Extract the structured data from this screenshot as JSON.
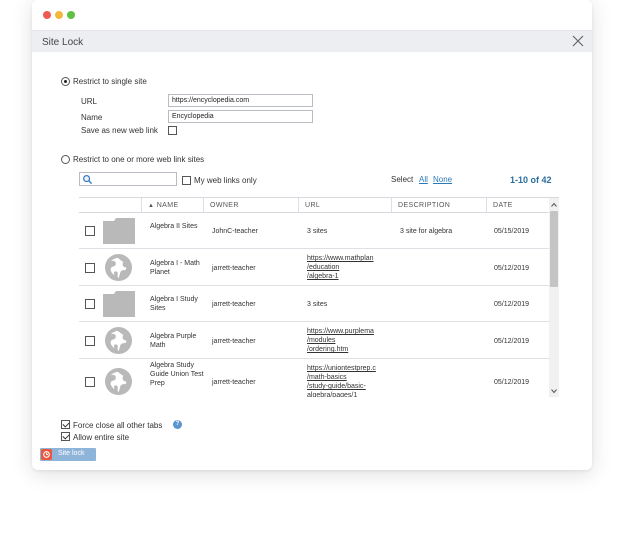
{
  "window": {
    "title": "Site Lock"
  },
  "restrict_single": {
    "label": "Restrict to single site",
    "url_label": "URL",
    "url_value": "https://encyclopedia.com",
    "name_label": "Name",
    "name_value": "Encyclopedia",
    "save_label": "Save as new web link"
  },
  "restrict_multi": {
    "label": "Restrict to one or more web link sites",
    "my_links_label": "My web links only",
    "select_label": "Select",
    "select_all": "All",
    "select_none": "None",
    "count": "1-10 of 42"
  },
  "table": {
    "columns": [
      "NAME",
      "OWNER",
      "URL",
      "DESCRIPTION",
      "DATE"
    ],
    "rows": [
      {
        "icon": "folder-icon",
        "name": "Algebra II Sites",
        "owner": "JohnC-teacher",
        "url": "3 sites",
        "url_is_link": false,
        "description": "3 site for algebra",
        "date": "05/15/2019"
      },
      {
        "icon": "globe-icon",
        "name": "Algebra I - Math Planet",
        "owner": "jarrett-teacher",
        "url": "https://www.mathplan /education /algebra-1",
        "url_is_link": true,
        "description": "",
        "date": "05/12/2019"
      },
      {
        "icon": "folder-icon",
        "name": "Algebra I Study Sites",
        "owner": "jarrett-teacher",
        "url": "3 sites",
        "url_is_link": false,
        "description": "",
        "date": "05/12/2019"
      },
      {
        "icon": "globe-icon",
        "name": "Algebra Purple Math",
        "owner": "jarrett-teacher",
        "url": "https://www.purplema /modules /ordering.htm",
        "url_is_link": true,
        "description": "",
        "date": "05/12/2019"
      },
      {
        "icon": "globe-icon",
        "name": "Algebra Study Guide Union Test Prep",
        "owner": "jarrett-teacher",
        "url": "https://uniontestprep.c /math-basics /study-guide/basic- algebra/pages/1",
        "url_is_link": true,
        "description": "",
        "date": "05/12/2019"
      }
    ]
  },
  "options": {
    "force_close": "Force close all other tabs",
    "allow_entire": "Allow entire site"
  },
  "actions": {
    "site_lock": "Site lock"
  },
  "colors": {
    "accent": "#2a7ab8",
    "count": "#2a6e9c",
    "button": "#8fb4d9",
    "button_icon": "#e8573e"
  }
}
